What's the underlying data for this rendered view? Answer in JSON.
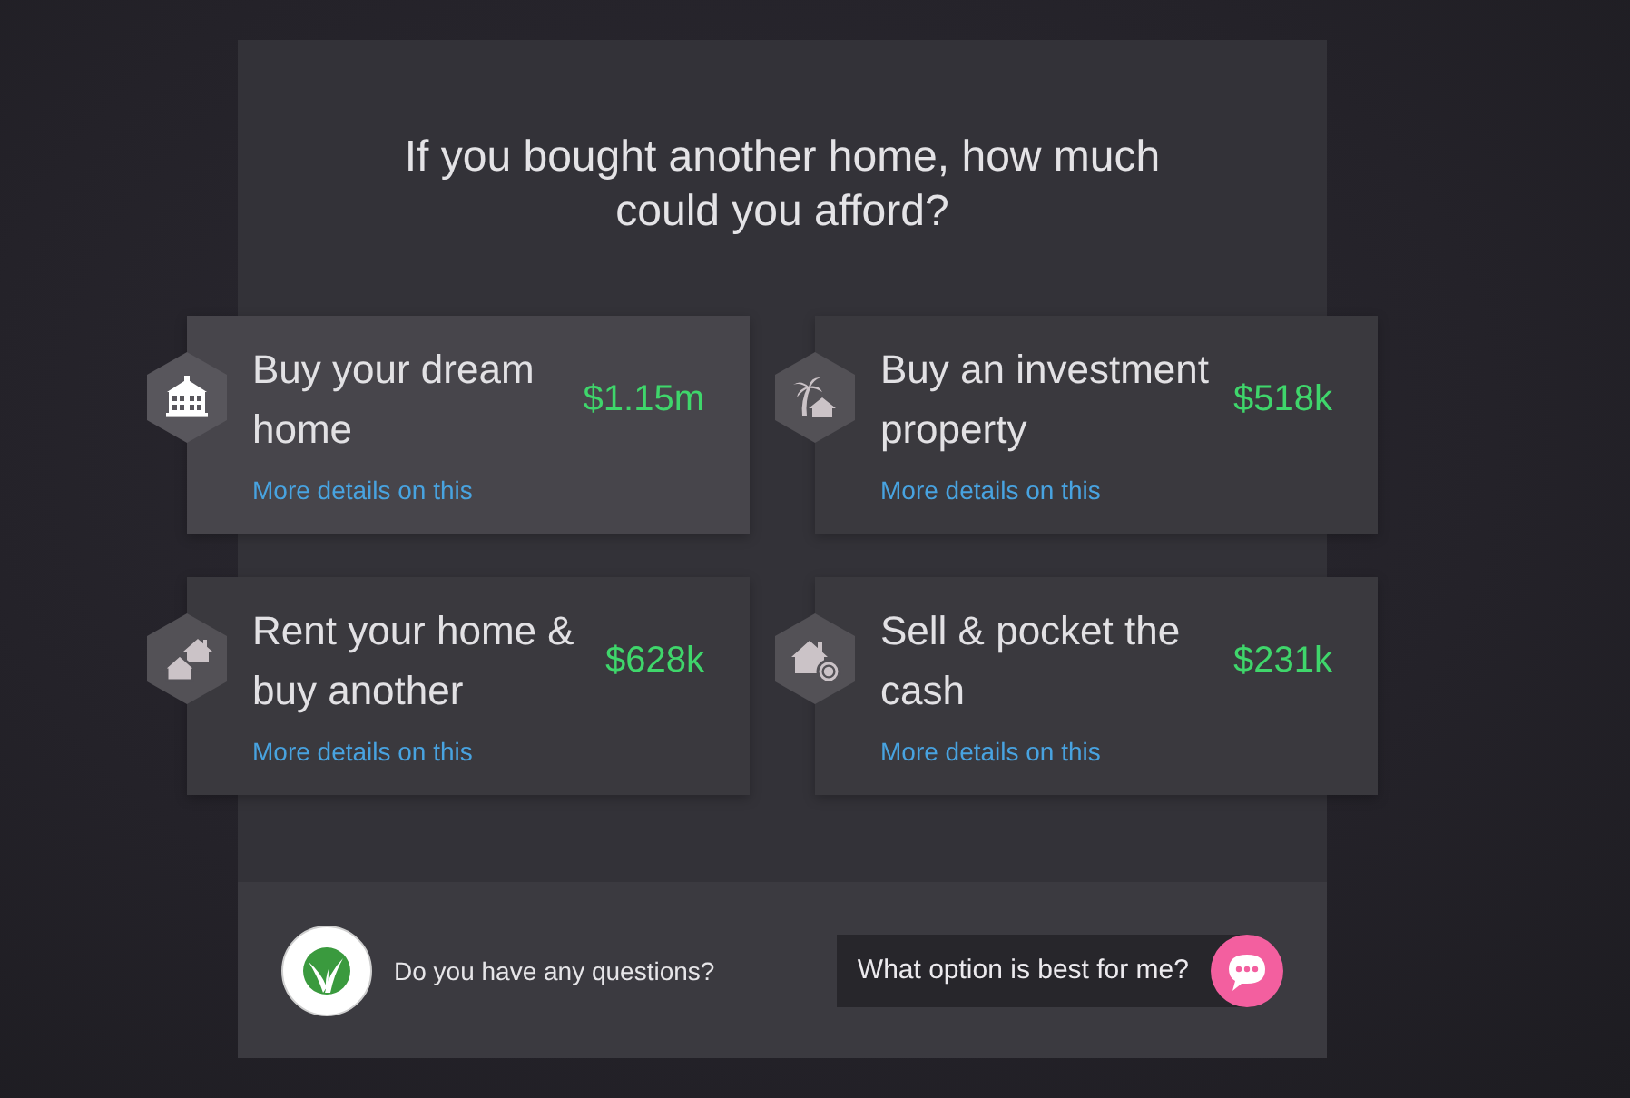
{
  "title": "If you bought another home, how much could you afford?",
  "options": [
    {
      "kind": "building",
      "title": "Buy your dream home",
      "value": "$1.15m",
      "link": "More details on this",
      "selected": true
    },
    {
      "kind": "palm-house",
      "title": "Buy an investment property",
      "value": "$518k",
      "link": "More details on this",
      "selected": false
    },
    {
      "kind": "two-houses",
      "title": "Rent your home & buy another",
      "value": "$628k",
      "link": "More details on this",
      "selected": false
    },
    {
      "kind": "house-coin",
      "title": "Sell & pocket the cash",
      "value": "$231k",
      "link": "More details on this",
      "selected": false
    }
  ],
  "footer": {
    "prompt": "Do you have any questions?",
    "question_button": "What option is best for me?"
  }
}
